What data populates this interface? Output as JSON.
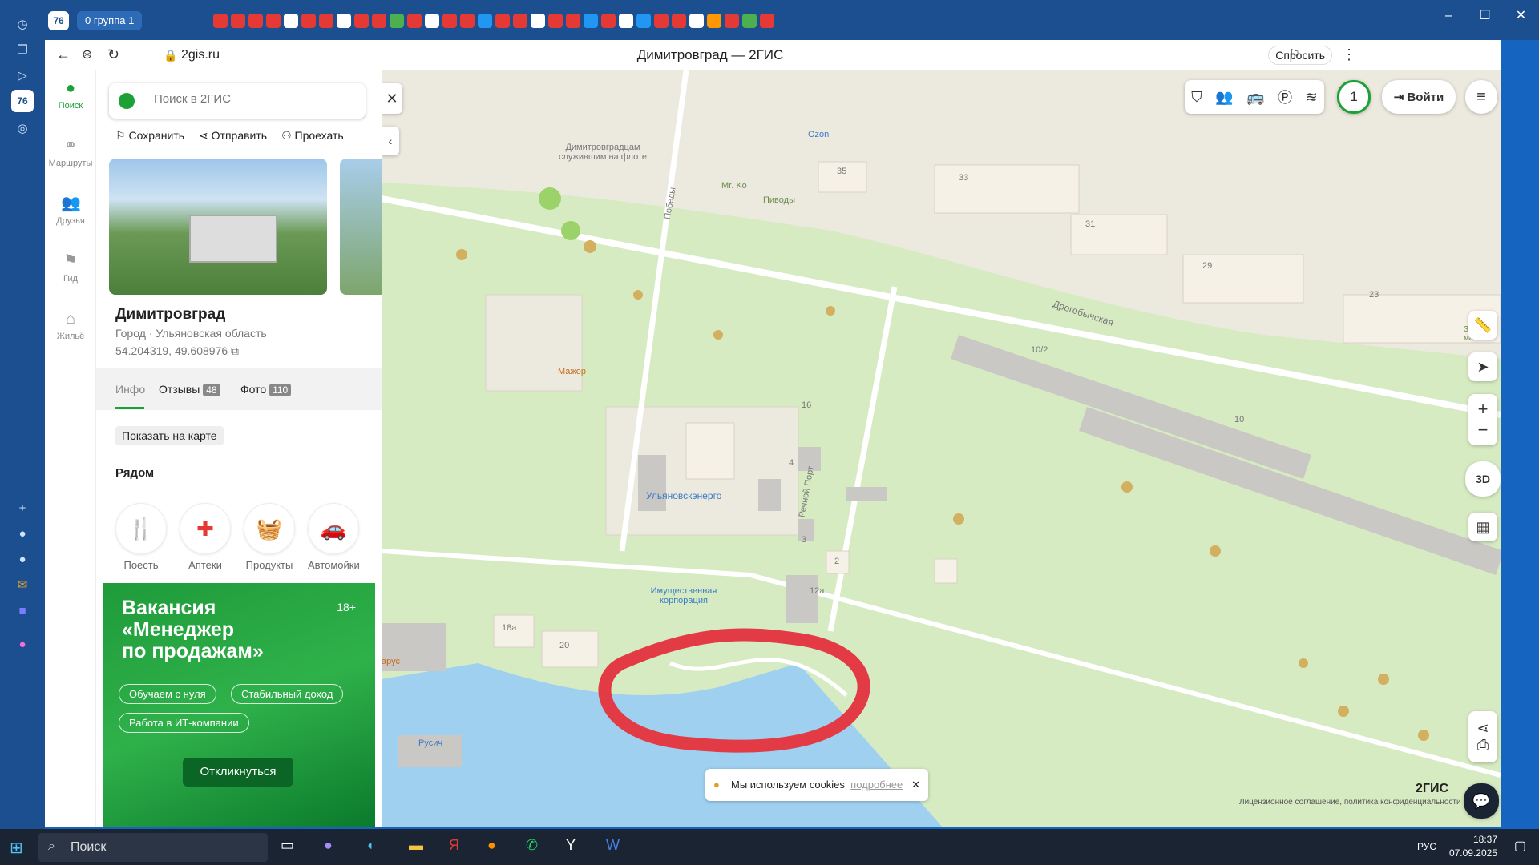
{
  "tabs_bar": {
    "group_count": "76",
    "group_label": "0  группа 1"
  },
  "address_bar": {
    "url": "2gis.ru",
    "page_title": "Димитровград — 2ГИС",
    "ask_label": "Спросить"
  },
  "leftnav": {
    "items": [
      {
        "label": "Поиск"
      },
      {
        "label": "Маршруты"
      },
      {
        "label": "Друзья"
      },
      {
        "label": "Гид"
      },
      {
        "label": "Жильё"
      }
    ]
  },
  "panel": {
    "search_placeholder": "Поиск в 2ГИС",
    "actions": [
      "Сохранить",
      "Отправить",
      "Проехать"
    ],
    "city_name": "Димитровград",
    "city_kind": "Город",
    "city_region": "Ульяновская область",
    "coords": "54.204319, 49.608976",
    "tabs": {
      "info": "Инфо",
      "reviews": "Отзывы",
      "reviews_count": "48",
      "photos": "Фото",
      "photos_count": "110"
    },
    "show_on_map": "Показать на карте",
    "nearby_title": "Рядом",
    "categories": [
      {
        "label": "Поесть",
        "icon": "fork-knife-icon"
      },
      {
        "label": "Аптеки",
        "icon": "pill-icon"
      },
      {
        "label": "Продукты",
        "icon": "basket-icon"
      },
      {
        "label": "Автомойки",
        "icon": "car-wash-icon"
      }
    ]
  },
  "ad": {
    "headline_1": "Вакансия",
    "headline_2": "«Менеджер",
    "headline_3": "по продажам»",
    "age": "18+",
    "chips": [
      "Обучаем с нуля",
      "Стабильный доход",
      "Работа в ИТ-компании"
    ],
    "cta": "Откликнуться"
  },
  "map": {
    "labels": {
      "monument": "Димитровградцам служившим на флоте",
      "ozon": "Ozon",
      "mrko": "Mr. Ko",
      "pivody": "Пиводы",
      "street_pobedy": "Победы",
      "street_drogobych": "Дрогобычская",
      "street_port": "Речной Порт",
      "mazhor": "Мажор",
      "energo": "Ульяновскэнерго",
      "corp": "Имущественная корпорация",
      "rusich": "Русич",
      "varus": "арус",
      "zveni": "Звени магаз"
    },
    "houses": [
      "35",
      "33",
      "31",
      "29",
      "23",
      "10/2",
      "10",
      "16",
      "4",
      "3",
      "2",
      "12а",
      "18а",
      "20"
    ],
    "login_label": "Войти",
    "notif_count": "1",
    "view3d": "3D",
    "brand": "2ГИС",
    "footer_text": "Лицензионное соглашение, политика конфиденциальности",
    "cookie_text": "Мы используем cookies",
    "cookie_more": "подробнее"
  },
  "taskbar": {
    "search_label": "Поиск",
    "lang": "РУС",
    "time": "18:37",
    "date": "07.09.2025"
  },
  "colors": {
    "brand_green": "#1ba136",
    "water": "#9fd0ef",
    "park": "#d7ebc2",
    "highlight": "#e23b45"
  }
}
